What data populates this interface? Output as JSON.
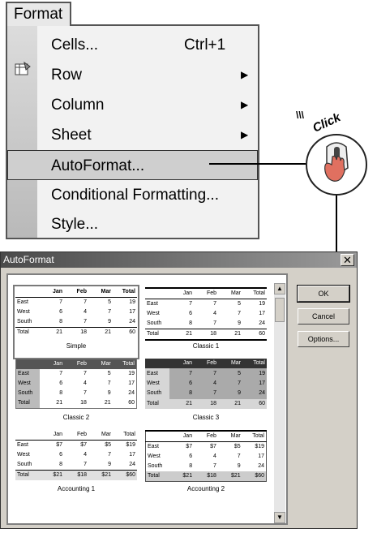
{
  "menu": {
    "title": "Format",
    "items": [
      {
        "label": "Cells...",
        "shortcut": "Ctrl+1"
      },
      {
        "label": "Row"
      },
      {
        "label": "Column"
      },
      {
        "label": "Sheet"
      },
      {
        "label": "AutoFormat..."
      },
      {
        "label": "Conditional Formatting..."
      },
      {
        "label": "Style..."
      }
    ]
  },
  "callout": {
    "text": "Click"
  },
  "dialog": {
    "title": "AutoFormat",
    "buttons": {
      "ok": "OK",
      "cancel": "Cancel",
      "options": "Options..."
    },
    "formats": [
      {
        "name": "Simple",
        "rows": [
          [
            "",
            "Jan",
            "Feb",
            "Mar",
            "Total"
          ],
          [
            "East",
            "7",
            "7",
            "5",
            "19"
          ],
          [
            "West",
            "6",
            "4",
            "7",
            "17"
          ],
          [
            "South",
            "8",
            "7",
            "9",
            "24"
          ],
          [
            "Total",
            "21",
            "18",
            "21",
            "60"
          ]
        ]
      },
      {
        "name": "Classic 1",
        "rows": [
          [
            "",
            "Jan",
            "Feb",
            "Mar",
            "Total"
          ],
          [
            "East",
            "7",
            "7",
            "5",
            "19"
          ],
          [
            "West",
            "6",
            "4",
            "7",
            "17"
          ],
          [
            "South",
            "8",
            "7",
            "9",
            "24"
          ],
          [
            "Total",
            "21",
            "18",
            "21",
            "60"
          ]
        ]
      },
      {
        "name": "Classic 2",
        "rows": [
          [
            "",
            "Jan",
            "Feb",
            "Mar",
            "Total"
          ],
          [
            "East",
            "7",
            "7",
            "5",
            "19"
          ],
          [
            "West",
            "6",
            "4",
            "7",
            "17"
          ],
          [
            "South",
            "8",
            "7",
            "9",
            "24"
          ],
          [
            "Total",
            "21",
            "18",
            "21",
            "60"
          ]
        ]
      },
      {
        "name": "Classic 3",
        "rows": [
          [
            "",
            "Jan",
            "Feb",
            "Mar",
            "Total"
          ],
          [
            "East",
            "7",
            "7",
            "5",
            "19"
          ],
          [
            "West",
            "6",
            "4",
            "7",
            "17"
          ],
          [
            "South",
            "8",
            "7",
            "9",
            "24"
          ],
          [
            "Total",
            "21",
            "18",
            "21",
            "60"
          ]
        ]
      },
      {
        "name": "Accounting 1",
        "rows": [
          [
            "",
            "Jan",
            "Feb",
            "Mar",
            "Total"
          ],
          [
            "East",
            "$7",
            "$7",
            "$5",
            "$19"
          ],
          [
            "West",
            "6",
            "4",
            "7",
            "17"
          ],
          [
            "South",
            "8",
            "7",
            "9",
            "24"
          ],
          [
            "Total",
            "$21",
            "$18",
            "$21",
            "$60"
          ]
        ]
      },
      {
        "name": "Accounting 2",
        "rows": [
          [
            "",
            "Jan",
            "Feb",
            "Mar",
            "Total"
          ],
          [
            "East",
            "$7",
            "$7",
            "$5",
            "$19"
          ],
          [
            "West",
            "6",
            "4",
            "7",
            "17"
          ],
          [
            "South",
            "8",
            "7",
            "9",
            "24"
          ],
          [
            "Total",
            "$21",
            "$18",
            "$21",
            "$60"
          ]
        ]
      }
    ]
  }
}
